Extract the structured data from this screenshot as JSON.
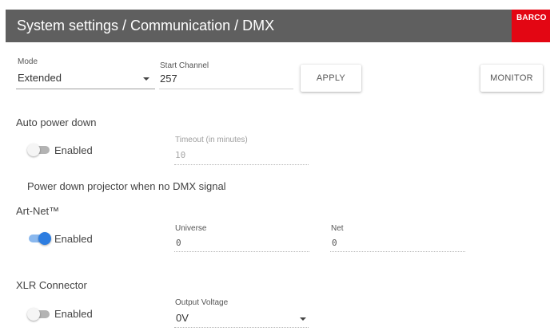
{
  "header": {
    "title": "System settings / Communication / DMX",
    "brand_logo": "BARCO",
    "bar_color": "#5f5f5f",
    "brand_color": "#e30613"
  },
  "dmx": {
    "mode_label": "Mode",
    "mode_value": "Extended",
    "start_channel_label": "Start Channel",
    "start_channel_value": "257",
    "apply_label": "APPLY",
    "monitor_label": "MONITOR"
  },
  "auto_power_down": {
    "title": "Auto power down",
    "toggle_label": "Enabled",
    "enabled": false,
    "timeout_label": "Timeout (in minutes)",
    "timeout_value": "10",
    "note": "Power down projector when no DMX signal"
  },
  "artnet": {
    "title": "Art-Net™",
    "toggle_label": "Enabled",
    "enabled": true,
    "universe_label": "Universe",
    "universe_value": "0",
    "net_label": "Net",
    "net_value": "0",
    "accent_color": "#2d7de0"
  },
  "xlr": {
    "title": "XLR Connector",
    "toggle_label": "Enabled",
    "enabled": false,
    "output_voltage_label": "Output Voltage",
    "output_voltage_value": "0V"
  }
}
